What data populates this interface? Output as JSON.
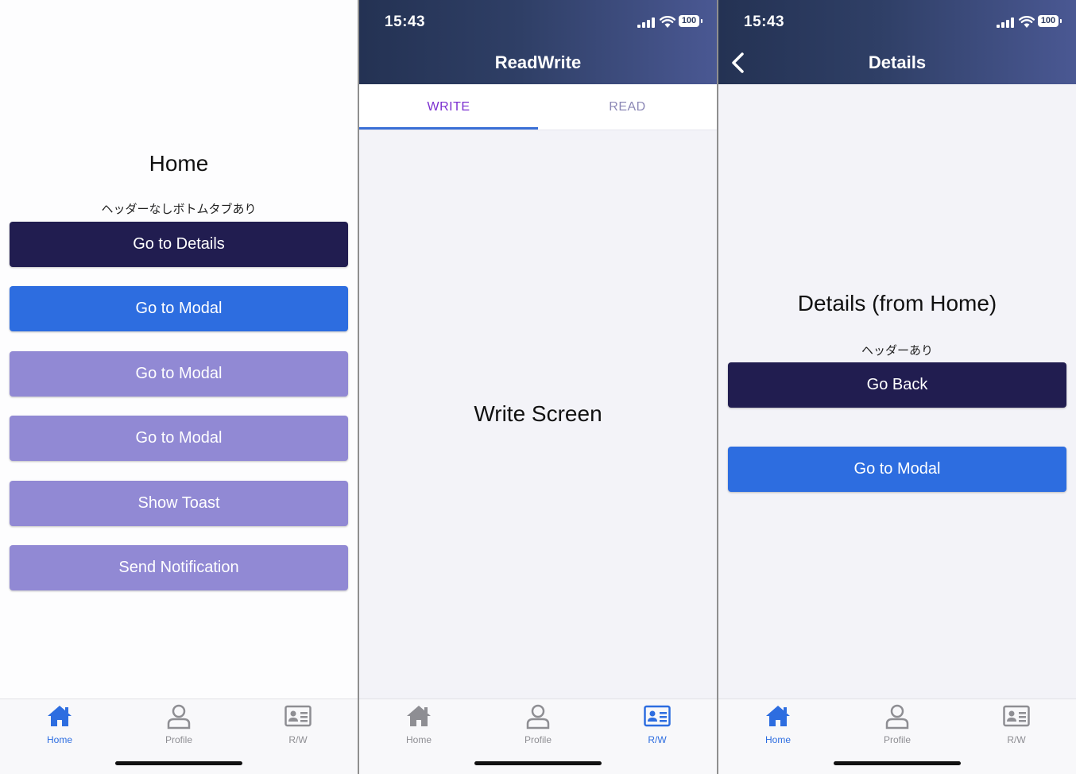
{
  "colors": {
    "navy": "#211d50",
    "blue": "#2d6de0",
    "lavender": "#9189d4",
    "tab_active": "#7b2fd0",
    "tab_inactive": "#8c88b6",
    "header_gradient_start": "#243253",
    "header_gradient_end": "#4a5893"
  },
  "status_bar": {
    "time": "15:43",
    "battery": "100"
  },
  "tab_bar": {
    "items": [
      {
        "label": "Home",
        "icon": "house-icon"
      },
      {
        "label": "Profile",
        "icon": "person-icon"
      },
      {
        "label": "R/W",
        "icon": "id-card-icon"
      }
    ]
  },
  "home_screen": {
    "title": "Home",
    "subtitle": "ヘッダーなしボトムタブあり",
    "buttons": [
      "Go to Details",
      "Go to Modal",
      "Go to Modal",
      "Go to Modal",
      "Show Toast",
      "Send Notification"
    ],
    "active_tab": "Home"
  },
  "readwrite_screen": {
    "header_title": "ReadWrite",
    "tabs": [
      "WRITE",
      "READ"
    ],
    "selected_tab": "WRITE",
    "content": "Write Screen",
    "active_tab": "R/W"
  },
  "details_screen": {
    "header_title": "Details",
    "title": "Details (from Home)",
    "subtitle": "ヘッダーあり",
    "buttons": [
      "Go Back",
      "Go to Modal"
    ],
    "active_tab": "Home"
  }
}
